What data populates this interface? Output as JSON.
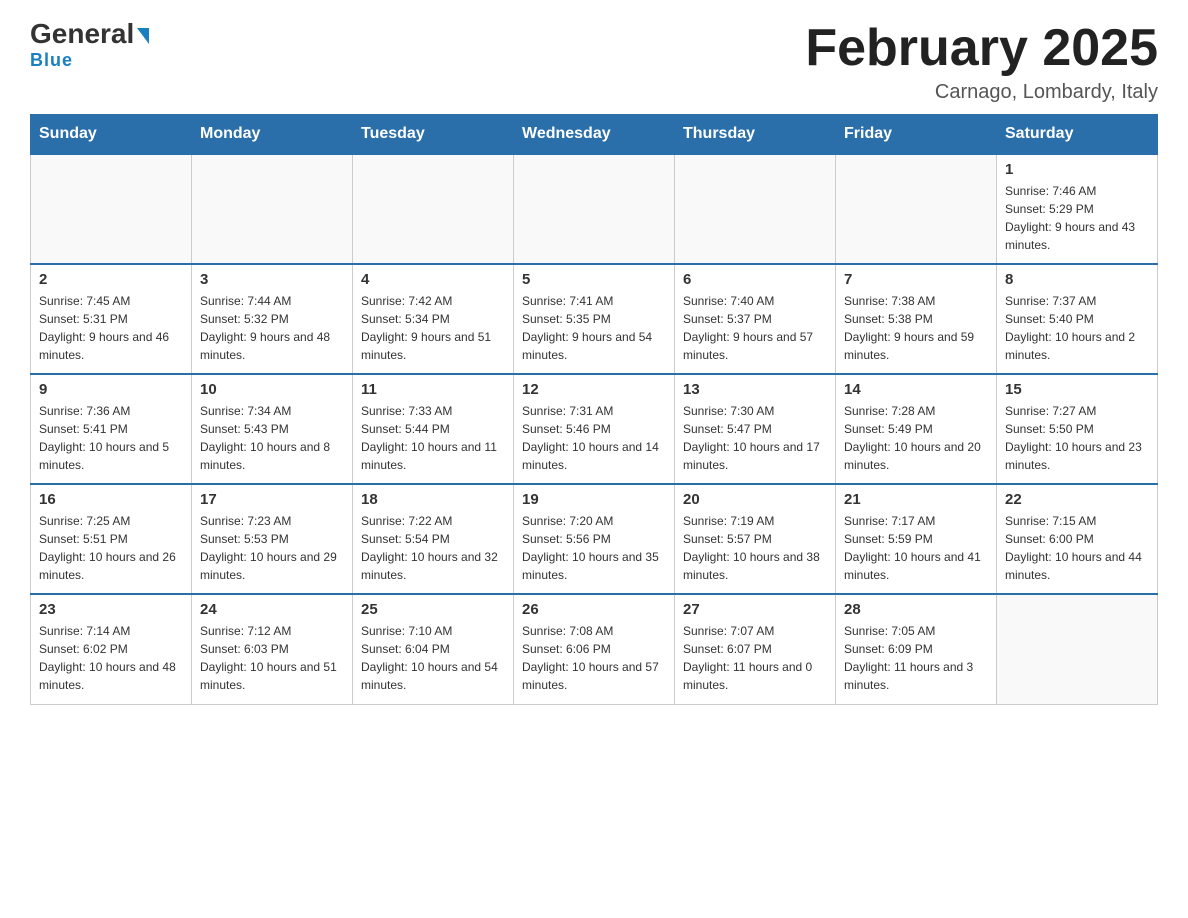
{
  "header": {
    "logo_main": "General",
    "logo_sub": "Blue",
    "month_title": "February 2025",
    "subtitle": "Carnago, Lombardy, Italy"
  },
  "days_of_week": [
    "Sunday",
    "Monday",
    "Tuesday",
    "Wednesday",
    "Thursday",
    "Friday",
    "Saturday"
  ],
  "weeks": [
    [
      {
        "day": "",
        "info": ""
      },
      {
        "day": "",
        "info": ""
      },
      {
        "day": "",
        "info": ""
      },
      {
        "day": "",
        "info": ""
      },
      {
        "day": "",
        "info": ""
      },
      {
        "day": "",
        "info": ""
      },
      {
        "day": "1",
        "info": "Sunrise: 7:46 AM\nSunset: 5:29 PM\nDaylight: 9 hours and 43 minutes."
      }
    ],
    [
      {
        "day": "2",
        "info": "Sunrise: 7:45 AM\nSunset: 5:31 PM\nDaylight: 9 hours and 46 minutes."
      },
      {
        "day": "3",
        "info": "Sunrise: 7:44 AM\nSunset: 5:32 PM\nDaylight: 9 hours and 48 minutes."
      },
      {
        "day": "4",
        "info": "Sunrise: 7:42 AM\nSunset: 5:34 PM\nDaylight: 9 hours and 51 minutes."
      },
      {
        "day": "5",
        "info": "Sunrise: 7:41 AM\nSunset: 5:35 PM\nDaylight: 9 hours and 54 minutes."
      },
      {
        "day": "6",
        "info": "Sunrise: 7:40 AM\nSunset: 5:37 PM\nDaylight: 9 hours and 57 minutes."
      },
      {
        "day": "7",
        "info": "Sunrise: 7:38 AM\nSunset: 5:38 PM\nDaylight: 9 hours and 59 minutes."
      },
      {
        "day": "8",
        "info": "Sunrise: 7:37 AM\nSunset: 5:40 PM\nDaylight: 10 hours and 2 minutes."
      }
    ],
    [
      {
        "day": "9",
        "info": "Sunrise: 7:36 AM\nSunset: 5:41 PM\nDaylight: 10 hours and 5 minutes."
      },
      {
        "day": "10",
        "info": "Sunrise: 7:34 AM\nSunset: 5:43 PM\nDaylight: 10 hours and 8 minutes."
      },
      {
        "day": "11",
        "info": "Sunrise: 7:33 AM\nSunset: 5:44 PM\nDaylight: 10 hours and 11 minutes."
      },
      {
        "day": "12",
        "info": "Sunrise: 7:31 AM\nSunset: 5:46 PM\nDaylight: 10 hours and 14 minutes."
      },
      {
        "day": "13",
        "info": "Sunrise: 7:30 AM\nSunset: 5:47 PM\nDaylight: 10 hours and 17 minutes."
      },
      {
        "day": "14",
        "info": "Sunrise: 7:28 AM\nSunset: 5:49 PM\nDaylight: 10 hours and 20 minutes."
      },
      {
        "day": "15",
        "info": "Sunrise: 7:27 AM\nSunset: 5:50 PM\nDaylight: 10 hours and 23 minutes."
      }
    ],
    [
      {
        "day": "16",
        "info": "Sunrise: 7:25 AM\nSunset: 5:51 PM\nDaylight: 10 hours and 26 minutes."
      },
      {
        "day": "17",
        "info": "Sunrise: 7:23 AM\nSunset: 5:53 PM\nDaylight: 10 hours and 29 minutes."
      },
      {
        "day": "18",
        "info": "Sunrise: 7:22 AM\nSunset: 5:54 PM\nDaylight: 10 hours and 32 minutes."
      },
      {
        "day": "19",
        "info": "Sunrise: 7:20 AM\nSunset: 5:56 PM\nDaylight: 10 hours and 35 minutes."
      },
      {
        "day": "20",
        "info": "Sunrise: 7:19 AM\nSunset: 5:57 PM\nDaylight: 10 hours and 38 minutes."
      },
      {
        "day": "21",
        "info": "Sunrise: 7:17 AM\nSunset: 5:59 PM\nDaylight: 10 hours and 41 minutes."
      },
      {
        "day": "22",
        "info": "Sunrise: 7:15 AM\nSunset: 6:00 PM\nDaylight: 10 hours and 44 minutes."
      }
    ],
    [
      {
        "day": "23",
        "info": "Sunrise: 7:14 AM\nSunset: 6:02 PM\nDaylight: 10 hours and 48 minutes."
      },
      {
        "day": "24",
        "info": "Sunrise: 7:12 AM\nSunset: 6:03 PM\nDaylight: 10 hours and 51 minutes."
      },
      {
        "day": "25",
        "info": "Sunrise: 7:10 AM\nSunset: 6:04 PM\nDaylight: 10 hours and 54 minutes."
      },
      {
        "day": "26",
        "info": "Sunrise: 7:08 AM\nSunset: 6:06 PM\nDaylight: 10 hours and 57 minutes."
      },
      {
        "day": "27",
        "info": "Sunrise: 7:07 AM\nSunset: 6:07 PM\nDaylight: 11 hours and 0 minutes."
      },
      {
        "day": "28",
        "info": "Sunrise: 7:05 AM\nSunset: 6:09 PM\nDaylight: 11 hours and 3 minutes."
      },
      {
        "day": "",
        "info": ""
      }
    ]
  ]
}
